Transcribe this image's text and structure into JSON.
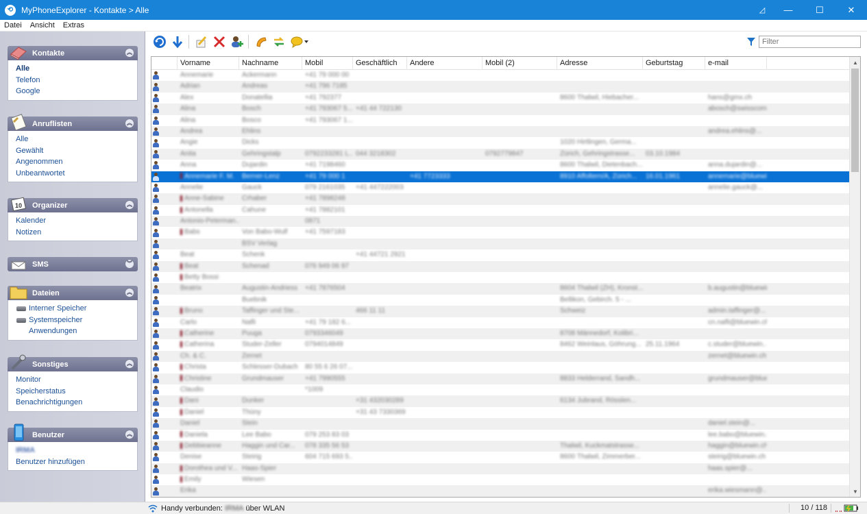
{
  "window": {
    "title": "MyPhoneExplorer -  Kontakte > Alle",
    "controls": [
      "◿",
      "—",
      "☐",
      "✕"
    ]
  },
  "menubar": [
    "Datei",
    "Ansicht",
    "Extras"
  ],
  "sidebar": {
    "groups": [
      {
        "title": "Kontakte",
        "collapsed": false,
        "items": [
          "Alle",
          "Telefon",
          "Google"
        ],
        "active": "Alle"
      },
      {
        "title": "Anruflisten",
        "collapsed": false,
        "items": [
          "Alle",
          "Gewählt",
          "Angenommen",
          "Unbeantwortet"
        ]
      },
      {
        "title": "Organizer",
        "collapsed": false,
        "items": [
          "Kalender",
          "Notizen"
        ]
      },
      {
        "title": "SMS",
        "collapsed": true,
        "items": []
      },
      {
        "title": "Dateien",
        "collapsed": false,
        "items": [
          "Interner Speicher",
          "Systemspeicher",
          "Anwendungen"
        ]
      },
      {
        "title": "Sonstiges",
        "collapsed": false,
        "items": [
          "Monitor",
          "Speicherstatus",
          "Benachrichtigungen"
        ]
      },
      {
        "title": "Benutzer",
        "collapsed": false,
        "items": [
          "IRMA",
          "Benutzer hinzufügen"
        ]
      }
    ]
  },
  "toolbar": {
    "buttons": [
      "refresh-icon",
      "download-icon",
      "edit-icon",
      "delete-icon",
      "add-contact-icon",
      "call-icon",
      "sync-icon",
      "message-icon"
    ],
    "filter_placeholder": "Filter"
  },
  "table": {
    "columns": [
      "Vorname",
      "Nachname",
      "Mobil",
      "Geschäftlich",
      "Andere",
      "Mobil (2)",
      "Adresse",
      "Geburtstag",
      "e-mail"
    ],
    "selected_row": 9,
    "rows": [
      [
        "Annemarie",
        "Ackermann",
        "+41 79 000 00",
        "",
        "",
        "",
        "",
        "",
        ""
      ],
      [
        "Adrian",
        "Andreas",
        "+41 796 7185",
        "",
        "",
        "",
        "",
        "",
        ""
      ],
      [
        "Alex",
        "Donatellia",
        "+41 792377",
        "",
        "",
        "",
        "8600 Thalwil, Hiebacher...",
        "",
        "hans@gmx.ch"
      ],
      [
        "Alina",
        "Bosch",
        "+41 793067 5...",
        "+41 44 722130",
        "",
        "",
        "",
        "",
        "abosch@swisscom.ch"
      ],
      [
        "Alina",
        "Bosco",
        "+41 793067 1...",
        "",
        "",
        "",
        "",
        "",
        ""
      ],
      [
        "Andrea",
        "Ehlins",
        "",
        "",
        "",
        "",
        "",
        "",
        "andrea.ehlins@..."
      ],
      [
        "Angie",
        "Dicks",
        "",
        "",
        "",
        "",
        "1020 Hirtlingen, Germa...",
        "",
        ""
      ],
      [
        "Anita",
        "Gehringstalp",
        "0792233281 L...",
        "044 3218302",
        "",
        "0792779847",
        "Zürich, Gehringstrasse...",
        "03.10.1984",
        ""
      ],
      [
        "Anna",
        "Dujardin",
        "+41 7198460",
        "",
        "",
        "",
        "8600 Thalwil, Dietenbach...",
        "",
        "anna.dujardin@..."
      ],
      [
        "Annemarie F. M.",
        "Berner-Lenz",
        "+41 79 000 1",
        "",
        "+41 7723333",
        "",
        "8910 Affoltern/A, Zürich...",
        "16.01.1961",
        "annemarie@bluewin.ch"
      ],
      [
        "Annelie",
        "Gauck",
        "079 2161035",
        "+41 447222003",
        "",
        "",
        "",
        "",
        "annelie.gauck@..."
      ],
      [
        "Anne-Sabine",
        "Crhaber",
        "+41 7898248",
        "",
        "",
        "",
        "",
        "",
        ""
      ],
      [
        "Antonella",
        "Cahune",
        "+41 7882101",
        "",
        "",
        "",
        "",
        "",
        ""
      ],
      [
        "Antonio-Peterman...",
        "",
        "0871",
        "",
        "",
        "",
        "",
        "",
        ""
      ],
      [
        "Babs",
        "Von Babo-Wulf",
        "+41 7597183",
        "",
        "",
        "",
        "",
        "",
        ""
      ],
      [
        "",
        "BSV Verlag",
        "",
        "",
        "",
        "",
        "",
        "",
        ""
      ],
      [
        "Beat",
        "Schenk",
        "",
        "+41 44721 2921",
        "",
        "",
        "",
        "",
        ""
      ],
      [
        "Beat",
        "Schenad",
        "076 949 06 97",
        "",
        "",
        "",
        "",
        "",
        ""
      ],
      [
        "Betty Bossi",
        "",
        "",
        "",
        "",
        "",
        "",
        "",
        ""
      ],
      [
        "Beatrix",
        "Augustin-Andriess",
        "+41 7876504",
        "",
        "",
        "",
        "8604 Thalwil (ZH), Kronst...",
        "",
        "b.augustin@bluewin..."
      ],
      [
        "",
        "Buebnik",
        "",
        "",
        "",
        "",
        "Bellikon, Gebirch. 5 - ...",
        "",
        ""
      ],
      [
        "Bruno",
        "Taffinger und Ste...",
        "",
        "466 11 11",
        "",
        "",
        "Schweiz",
        "",
        "admin.taffinger@..."
      ],
      [
        "Carlo",
        "Nafli",
        "+41 79 182 6...",
        "",
        "",
        "",
        "",
        "",
        "cn.nafli@bluewin.ch"
      ],
      [
        "Catherine",
        "Puuga",
        "0793346049",
        "",
        "",
        "",
        "8708 Männedorf, Kolibri...",
        "",
        ""
      ],
      [
        "Catherina",
        "Studer-Zeller",
        "0794014849",
        "",
        "",
        "",
        "8462 Weinlaus, Göhrung...",
        "25.11.1964",
        "c.studer@bluewin..."
      ],
      [
        "Ch. & C.",
        "Zernet",
        "",
        "",
        "",
        "",
        "",
        "",
        "zernet@bluewin.ch"
      ],
      [
        "Christa",
        "Schlesser-Dubach",
        "80 55 6 26 07...",
        "",
        "",
        "",
        "",
        "",
        ""
      ],
      [
        "Christine",
        "Grundmauser",
        "+41 7990555",
        "",
        "",
        "",
        "8833 Helderrand, Sandh...",
        "",
        "grundmauser@bluewin..."
      ],
      [
        "Claudio",
        "",
        "*1009",
        "",
        "",
        "",
        "",
        "",
        ""
      ],
      [
        "Dani",
        "Dunker",
        "",
        "+31 432030289",
        "",
        "",
        "6134 Jubrand, Rösslen...",
        "",
        ""
      ],
      [
        "Daniel",
        "Thüny",
        "",
        "+31 43 7330369",
        "",
        "",
        "",
        "",
        ""
      ],
      [
        "Daniel",
        "Stein",
        "",
        "",
        "",
        "",
        "",
        "",
        "daniel.stein@..."
      ],
      [
        "Daniela",
        "Lee Babo",
        "079 253 83 03",
        "",
        "",
        "",
        "",
        "",
        "lee.babo@bluewin.ch"
      ],
      [
        "Debbieanne",
        "Haggin und Car...",
        "078 335 56 53",
        "",
        "",
        "",
        "Thalwil, Kuckmatstrasse...",
        "",
        "haggin@bluewin.ch"
      ],
      [
        "Denise",
        "Steirig",
        "604 715 693 5...",
        "",
        "",
        "",
        "8600 Thalwil, Zimmerber...",
        "",
        "steirig@bluewin.ch"
      ],
      [
        "Dorothea und V...",
        "Haas-Spier",
        "",
        "",
        "",
        "",
        "",
        "",
        "haas.spier@..."
      ],
      [
        "Emily",
        "Wiesen",
        "",
        "",
        "",
        "",
        "",
        "",
        ""
      ],
      [
        "Erika",
        "",
        "",
        "",
        "",
        "",
        "",
        "",
        "erika.wiesmann@..."
      ]
    ]
  },
  "status": {
    "connection_label": "Handy verbunden:",
    "connection_user": "IRMA",
    "connection_via": "über WLAN",
    "count": "10 / 118"
  }
}
